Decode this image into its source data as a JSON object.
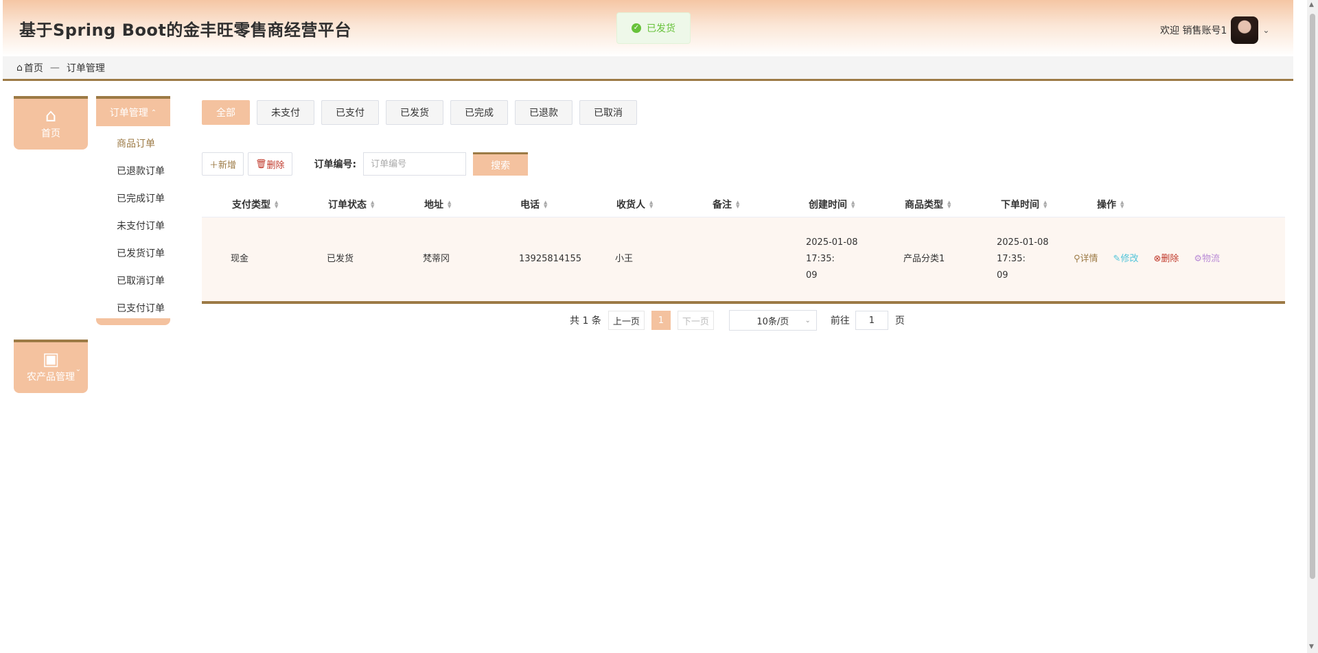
{
  "header": {
    "title": "基于Spring Boot的金丰旺零售商经营平台",
    "welcome": "欢迎 销售账号1"
  },
  "toast": {
    "text": "已发货",
    "type": "success"
  },
  "breadcrumb": {
    "home": "首页",
    "separator": "—",
    "current": "订单管理"
  },
  "nav": {
    "home_label": "首页",
    "order_menu_label": "订单管理",
    "agri_label": "农产品管理",
    "sub_items": [
      {
        "label": "商品订单"
      },
      {
        "label": "已退款订单"
      },
      {
        "label": "已完成订单"
      },
      {
        "label": "未支付订单"
      },
      {
        "label": "已发货订单"
      },
      {
        "label": "已取消订单"
      },
      {
        "label": "已支付订单"
      }
    ]
  },
  "tabs": [
    "全部",
    "未支付",
    "已支付",
    "已发货",
    "已完成",
    "已退款",
    "已取消"
  ],
  "toolbar": {
    "add_label": "新增",
    "delete_label": "删除",
    "order_no_label": "订单编号:",
    "order_no_placeholder": "订单编号",
    "order_no_value": "",
    "search_label": "搜索"
  },
  "table": {
    "headers": [
      "支付类型",
      "订单状态",
      "地址",
      "电话",
      "收货人",
      "备注",
      "创建时间",
      "商品类型",
      "下单时间",
      "操作"
    ],
    "rows": [
      {
        "pay_type": "现金",
        "status": "已发货",
        "address": "梵蒂冈",
        "phone": "13925814155",
        "receiver": "小王",
        "remark": "",
        "created_1": "2025-01-08 17:35:",
        "created_2": "09",
        "category": "产品分类1",
        "ordered_1": "2025-01-08 17:35:",
        "ordered_2": "09",
        "ops": {
          "detail": "详情",
          "edit": "修改",
          "delete": "删除",
          "logistics": "物流"
        }
      }
    ]
  },
  "pagination": {
    "total": "共 1 条",
    "prev": "上一页",
    "current": "1",
    "next": "下一页",
    "page_size": "10条/页",
    "goto_label": "前往",
    "goto_value": "1",
    "page_unit": "页"
  },
  "colors": {
    "accent": "#f4c29f",
    "accent_dark": "#9c7a45",
    "success": "#67c23a",
    "edit": "#4fc3d9",
    "danger": "#c0392b",
    "logistics": "#b98bd6"
  },
  "icons": {
    "home": "home-icon",
    "briefcase": "briefcase-icon",
    "check": "check-circle-icon",
    "search": "search-icon"
  }
}
